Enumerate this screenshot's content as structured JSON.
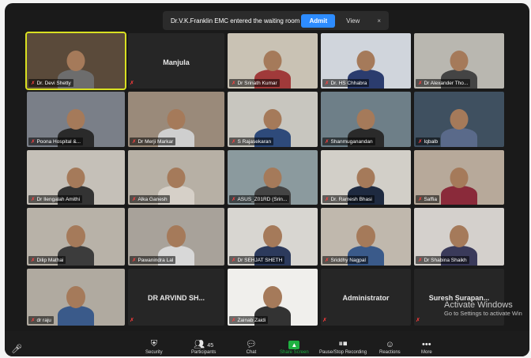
{
  "notification": {
    "message": "Dr.V.K.Franklin EMC entered the waiting room",
    "admit_label": "Admit",
    "view_label": "View",
    "close_glyph": "×"
  },
  "participants": [
    {
      "name": "Dr. Devi Shetty",
      "video": true,
      "active": true
    },
    {
      "name": "Manjula",
      "video": false
    },
    {
      "name": "Dr Srinath Kumar",
      "video": true
    },
    {
      "name": "Dr. HS Chhabra",
      "video": true
    },
    {
      "name": "Dr Alexander Tho...",
      "video": true
    },
    {
      "name": "Poona Hospital &...",
      "video": true
    },
    {
      "name": "Dr Merji Markar",
      "video": true
    },
    {
      "name": "S Rajasekaran",
      "video": true
    },
    {
      "name": "Shanmuganandan",
      "video": true
    },
    {
      "name": "Iqbalb",
      "video": true
    },
    {
      "name": "Dr Ilengalah Amithi",
      "video": true
    },
    {
      "name": "Alka Ganesh",
      "video": true
    },
    {
      "name": "ASUS_Z01RD (Srin...",
      "video": true
    },
    {
      "name": "Dr. Ramesh Bhasi",
      "video": true
    },
    {
      "name": "Saffia",
      "video": true
    },
    {
      "name": "Dilip Mathai",
      "video": true
    },
    {
      "name": "Pawanindra Lal",
      "video": true
    },
    {
      "name": "Dr SEHJAT SHETH",
      "video": true
    },
    {
      "name": "Sriddhy Nagpal",
      "video": true
    },
    {
      "name": "Dr Shabina Shaikh",
      "video": true
    },
    {
      "name": "dr raju",
      "video": true
    },
    {
      "name": "DR ARVIND SH...",
      "video": false
    },
    {
      "name": "Zainab Zaidi",
      "video": true
    },
    {
      "name": "Administrator",
      "video": false
    },
    {
      "name": "Suresh Surapan...",
      "video": false
    }
  ],
  "toolbar": {
    "security": "Security",
    "participants": "Participants",
    "participants_count": "45",
    "chat": "Chat",
    "share": "Share Screen",
    "record": "Pause/Stop Recording",
    "reactions": "Reactions",
    "more": "More"
  },
  "watermark": {
    "title": "Activate Windows",
    "subtitle": "Go to Settings to activate Win"
  },
  "colors": {
    "active_border": "#d9e021",
    "admit_blue": "#2d8cff",
    "share_green": "#1fb141",
    "muted_red": "#ff3b3b"
  }
}
